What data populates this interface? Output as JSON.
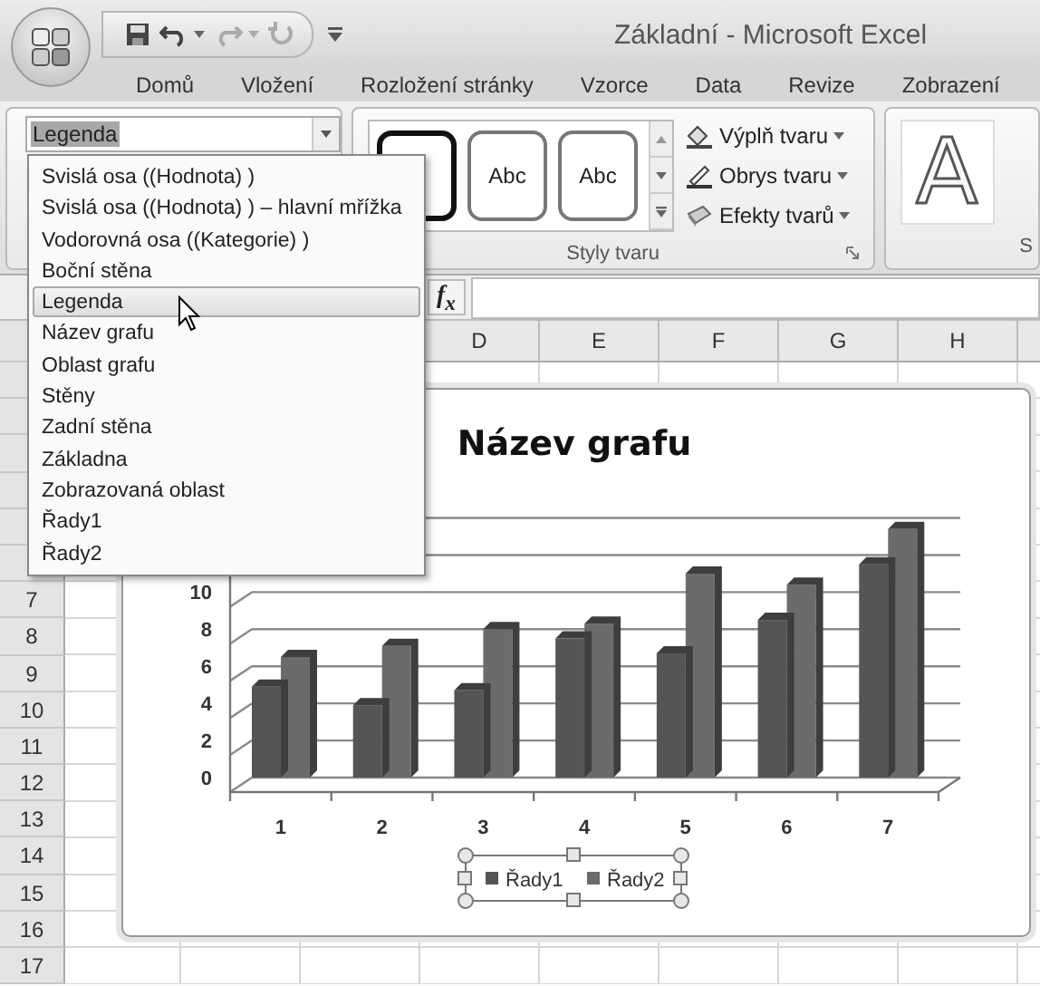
{
  "window": {
    "title": "Základní - Microsoft Excel"
  },
  "tabs": [
    {
      "label": "Domů",
      "selected": false
    },
    {
      "label": "Vložení",
      "selected": false
    },
    {
      "label": "Rozložení stránky",
      "selected": false
    },
    {
      "label": "Vzorce",
      "selected": false
    },
    {
      "label": "Data",
      "selected": false
    },
    {
      "label": "Revize",
      "selected": false
    },
    {
      "label": "Zobrazení",
      "selected": false
    }
  ],
  "ribbon": {
    "element_selector": {
      "value": "Legenda"
    },
    "shape_styles": {
      "swatches": [
        {
          "selected": true
        },
        {
          "label": "Abc",
          "selected": false
        },
        {
          "label": "Abc",
          "selected": false
        }
      ],
      "commands": [
        "Výplň tvaru",
        "Obrys tvaru",
        "Efekty tvarů"
      ],
      "group_label": "Styly tvaru"
    },
    "wordart": {
      "sample": "A",
      "group_label": "S"
    }
  },
  "dropdown": {
    "items": [
      {
        "label": "Svislá osa ((Hodnota) )",
        "selected": false
      },
      {
        "label": "Svislá osa ((Hodnota) ) – hlavní mřížka",
        "selected": false
      },
      {
        "label": "Vodorovná osa ((Kategorie) )",
        "selected": false
      },
      {
        "label": "Boční stěna",
        "selected": false
      },
      {
        "label": "Legenda",
        "selected": true
      },
      {
        "label": "Název grafu",
        "selected": false
      },
      {
        "label": "Oblast grafu",
        "selected": false
      },
      {
        "label": "Stěny",
        "selected": false
      },
      {
        "label": "Zadní stěna",
        "selected": false
      },
      {
        "label": "Základna",
        "selected": false
      },
      {
        "label": "Zobrazovaná oblast",
        "selected": false
      },
      {
        "label": "Řady1",
        "selected": false
      },
      {
        "label": "Řady2",
        "selected": false
      }
    ]
  },
  "formula_bar": {
    "function_button": "f$_{x}$"
  },
  "sheet": {
    "columns": [
      "D",
      "E",
      "F",
      "G",
      "H"
    ],
    "rows": [
      "7",
      "8",
      "9",
      "10",
      "11",
      "12",
      "13",
      "14",
      "15",
      "16",
      "17"
    ]
  },
  "chart": {
    "legend_selected": true,
    "chart_data": {
      "type": "bar",
      "title": "Název grafu",
      "categories": [
        "1",
        "2",
        "3",
        "4",
        "5",
        "6",
        "7"
      ],
      "series": [
        {
          "name": "Řady1",
          "color": "#555555",
          "values": [
            4.9,
            3.9,
            4.7,
            7.5,
            6.7,
            8.5,
            11.5
          ]
        },
        {
          "name": "Řady2",
          "color": "#6b6b6b",
          "values": [
            6.5,
            7.1,
            8,
            8.3,
            11,
            10.4,
            13.4
          ]
        }
      ],
      "ylim": [
        0,
        14
      ],
      "yticks": [
        0,
        2,
        4,
        6,
        8,
        10
      ],
      "grid": true,
      "legend": "bottom"
    }
  }
}
